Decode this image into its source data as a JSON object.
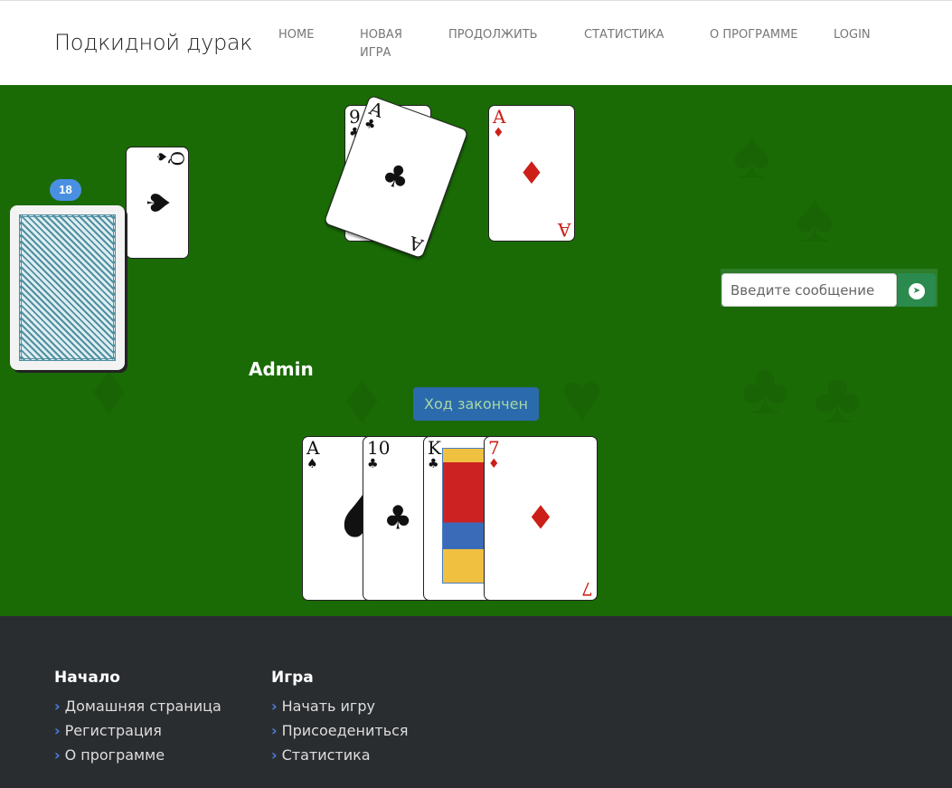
{
  "nav": {
    "brand": "Подкидной дурак",
    "items": [
      "HOME",
      "НОВАЯ ИГРА",
      "ПРОДОЛЖИТЬ",
      "СТАТИСТИКА",
      "О ПРОГРАММЕ",
      "LOGIN"
    ]
  },
  "game": {
    "deck_count": "18",
    "trump": {
      "rank": "Q",
      "suit": "♠"
    },
    "table": [
      {
        "rank": "9",
        "suit": "♣"
      },
      {
        "rank": "A",
        "suit": "♣"
      },
      {
        "rank": "A",
        "suit": "♦"
      }
    ],
    "player_name": "Admin",
    "end_turn_label": "Ход закончен",
    "hand": [
      {
        "rank": "A",
        "suit": "♠"
      },
      {
        "rank": "10",
        "suit": "♣"
      },
      {
        "rank": "K",
        "suit": "♣"
      },
      {
        "rank": "7",
        "suit": "♦"
      }
    ]
  },
  "chat": {
    "placeholder": "Введите сообщение",
    "send_icon": "telegram-send-icon"
  },
  "footer": {
    "col1": {
      "title": "Начало",
      "links": [
        "Домашняя страница",
        "Регистрация",
        "О программе"
      ]
    },
    "col2": {
      "title": "Игра",
      "links": [
        "Начать игру",
        "Присоедениться",
        "Статистика"
      ]
    }
  },
  "colors": {
    "table": "#1a6b06",
    "footer": "#2a2d30",
    "button": "#2b6aad"
  }
}
